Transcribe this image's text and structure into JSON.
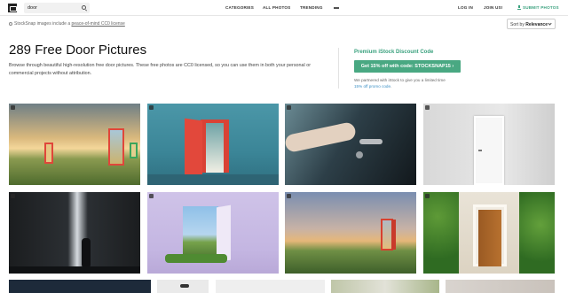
{
  "header": {
    "search_value": "door",
    "nav": {
      "categories": "CATEGORIES",
      "all_photos": "ALL PHOTOS",
      "trending": "TRENDING",
      "login": "LOG IN",
      "join": "JOIN US!",
      "submit": "SUBMIT PHOTOS"
    }
  },
  "license": {
    "prefix": "StockSnap images include a ",
    "link": "peace-of-mind CC0 license"
  },
  "sort": {
    "label": "Sort by ",
    "value": "Relevance"
  },
  "main": {
    "title": "289 Free Door Pictures",
    "description": "Browse through beautiful high-resolution free door pictures. These free photos are CC0 licensed, so you can use them in both your personal or commercial projects without attribution."
  },
  "promo": {
    "title": "Premium iStock Discount Code",
    "button": "Get 15% off with code: STOCKSNAP15 ›",
    "note_prefix": "We partnered with iStock to give you a limited time ",
    "note_link": "15% off promo code",
    "note_suffix": "."
  },
  "colors": {
    "accent_green": "#3aa17e",
    "promo_button": "#49a882",
    "link_blue": "#3a8fc4"
  },
  "icons": [
    "logo-icon",
    "search-icon",
    "more-icon",
    "upload-icon",
    "cc-icon",
    "chevron-down-icon"
  ]
}
